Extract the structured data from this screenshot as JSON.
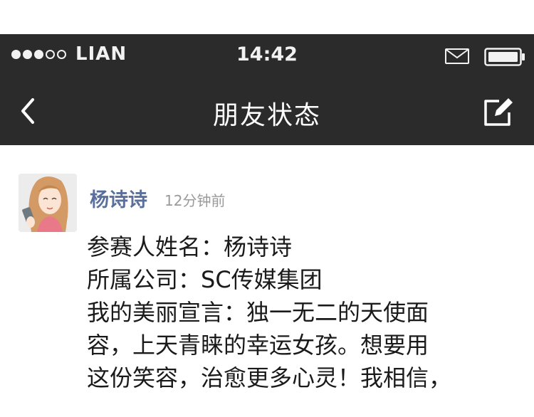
{
  "status_bar": {
    "signal_bars_filled": 3,
    "signal_bars_total": 5,
    "carrier": "LIAN",
    "time": "14:42",
    "icons": [
      "mail-icon",
      "battery-icon"
    ]
  },
  "nav": {
    "title": "朋友状态",
    "back_icon": "chevron-left-icon",
    "compose_icon": "compose-edit-icon"
  },
  "post": {
    "author": "杨诗诗",
    "time_ago": "12分钟前",
    "lines": [
      "参赛人姓名：杨诗诗",
      "所属公司：SC传媒集团",
      "我的美丽宣言：独一无二的天使面",
      "容，上天青睐的幸运女孩。想要用",
      "这份笑容，治愈更多心灵！我相信，"
    ]
  },
  "colors": {
    "bar_background": "#2b2b2b",
    "author_name": "#5a6f9c",
    "time_text": "#9a9a9a",
    "body_text": "#1a1a1a"
  }
}
